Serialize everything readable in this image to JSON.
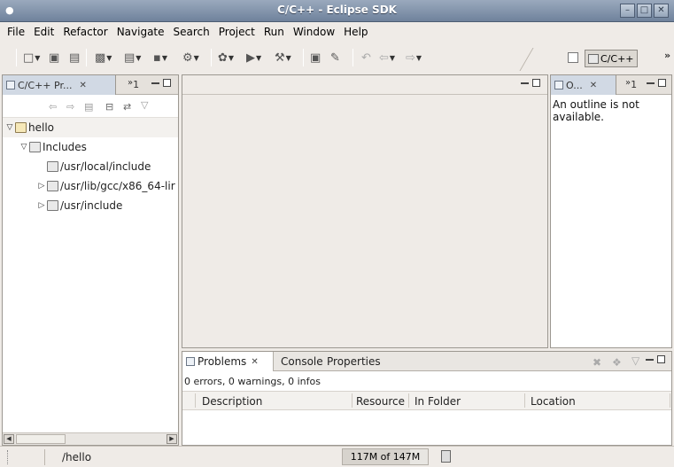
{
  "window": {
    "title": "C/C++ - Eclipse SDK",
    "controls": [
      "minimize",
      "maximize",
      "close"
    ]
  },
  "menubar": {
    "items": [
      {
        "label": "File",
        "mnemonic": "F"
      },
      {
        "label": "Edit",
        "mnemonic": "E"
      },
      {
        "label": "Refactor",
        "mnemonic": "t"
      },
      {
        "label": "Navigate",
        "mnemonic": "N"
      },
      {
        "label": "Search",
        "mnemonic": "a"
      },
      {
        "label": "Project",
        "mnemonic": "P"
      },
      {
        "label": "Run",
        "mnemonic": "R"
      },
      {
        "label": "Window",
        "mnemonic": "W"
      },
      {
        "label": "Help",
        "mnemonic": "H"
      }
    ]
  },
  "toolbar": {
    "perspective_label": "C/C++",
    "overflow": "»"
  },
  "project_explorer": {
    "tab_label": "C/C++ Pr...",
    "overflow_count": "1",
    "tree": [
      {
        "label": "hello",
        "level": 0,
        "expanded": true,
        "icon": "project-icon"
      },
      {
        "label": "Includes",
        "level": 1,
        "expanded": true,
        "icon": "includes-icon"
      },
      {
        "label": "/usr/local/include",
        "level": 2,
        "expanded": null,
        "icon": "include-folder-icon"
      },
      {
        "label": "/usr/lib/gcc/x86_64-lir",
        "level": 2,
        "expanded": false,
        "icon": "include-folder-icon"
      },
      {
        "label": "/usr/include",
        "level": 2,
        "expanded": false,
        "icon": "include-folder-icon"
      }
    ]
  },
  "outline": {
    "tab_label": "O...",
    "overflow_count": "1",
    "message": "An outline is not available."
  },
  "problems_view": {
    "tabs": [
      {
        "label": "Problems",
        "active": true
      },
      {
        "label": "Console",
        "active": false
      },
      {
        "label": "Properties",
        "active": false
      }
    ],
    "summary": "0 errors, 0 warnings, 0 infos",
    "columns": [
      "Description",
      "Resource",
      "In Folder",
      "Location"
    ]
  },
  "statusbar": {
    "selection": "/hello",
    "heap": "117M of 147M",
    "heap_used_fraction": 0.796
  },
  "colors": {
    "titlebar": "#7f91aa",
    "active_tab": "#d1d9e4",
    "chrome": "#efebe7"
  }
}
